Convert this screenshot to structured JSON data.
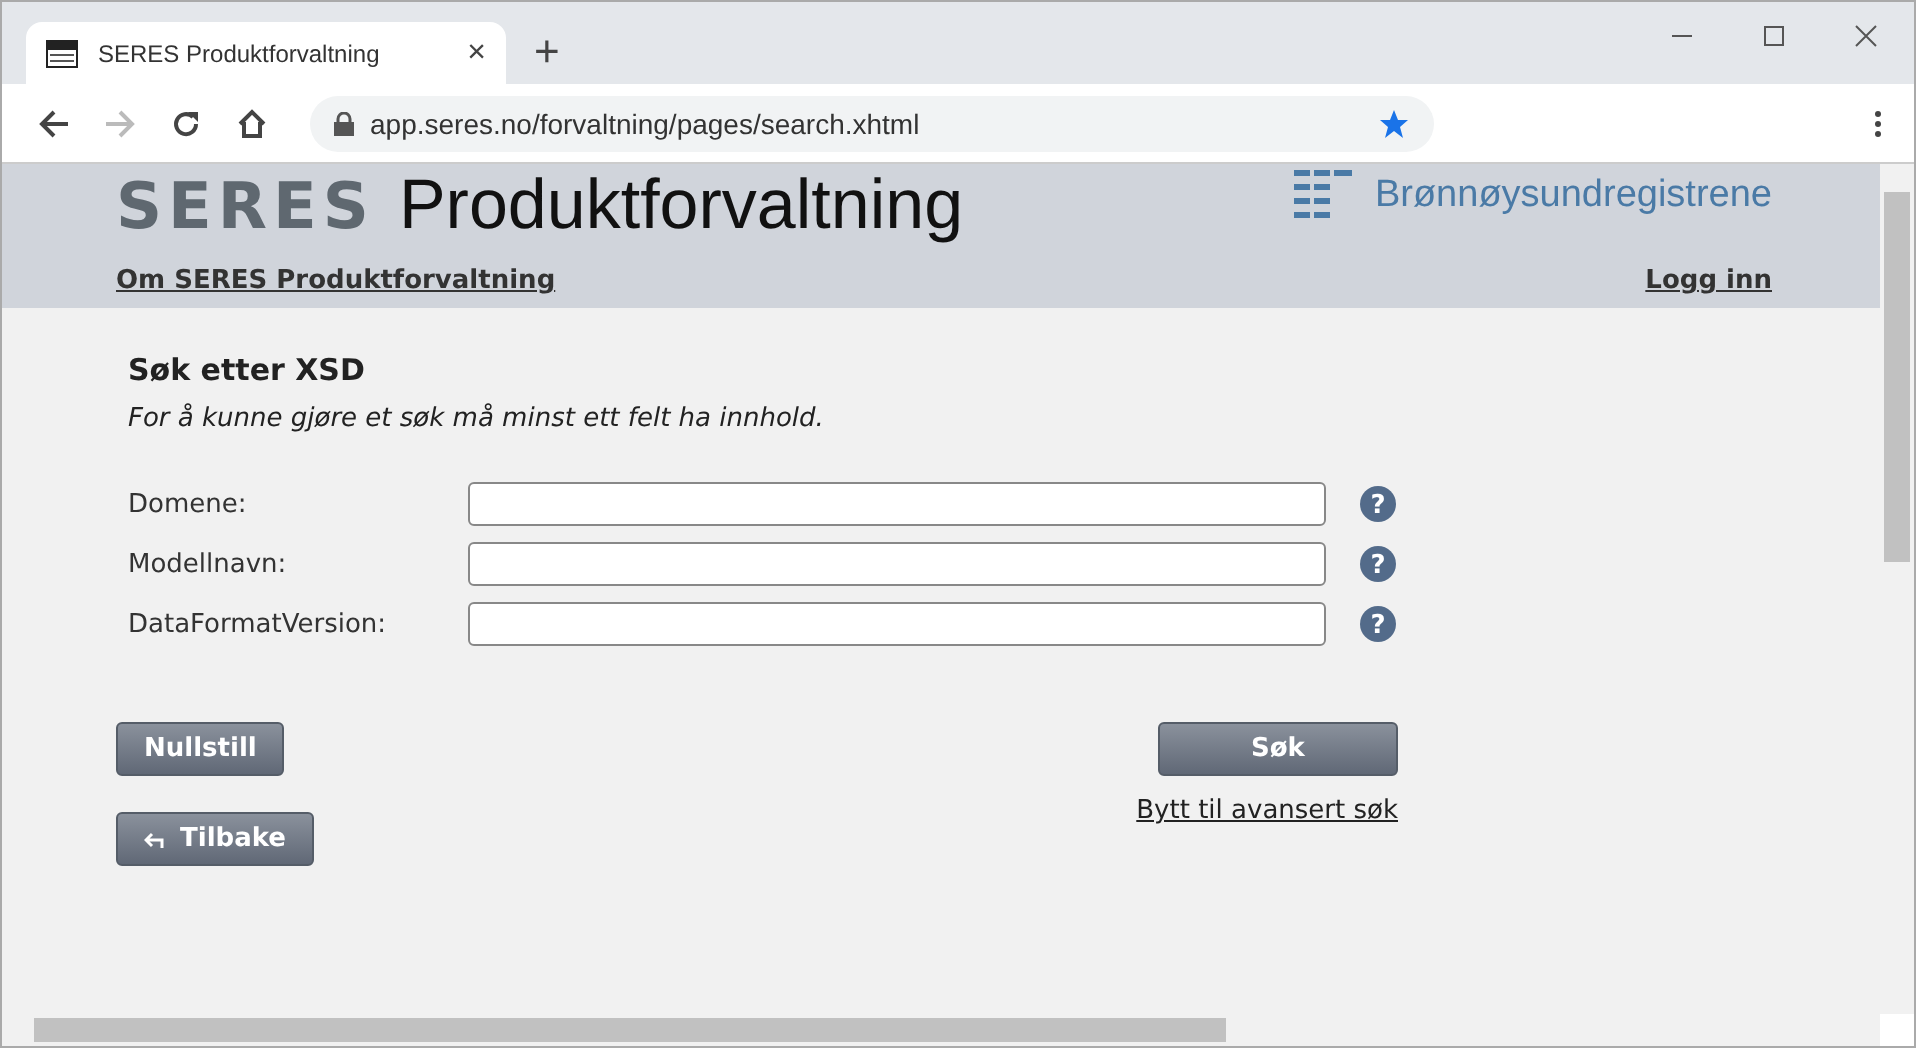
{
  "browser": {
    "tab": {
      "title": "SERES Produktforvaltning",
      "close": "×"
    },
    "new_tab": "+",
    "address": "app.seres.no/forvaltning/pages/search.xhtml"
  },
  "header": {
    "logo": "SERES",
    "title": "Produktforvaltning",
    "org": "Brønnøysundregistrene",
    "about_link": "Om SERES Produktforvaltning",
    "login_link": "Logg inn"
  },
  "form": {
    "heading": "Søk etter XSD",
    "hint": "For å kunne gjøre et søk må minst ett felt ha innhold.",
    "fields": [
      {
        "label": "Domene:",
        "help": "?"
      },
      {
        "label": "Modellnavn:",
        "help": "?"
      },
      {
        "label": "DataFormatVersion:",
        "help": "?"
      }
    ],
    "reset_button": "Nullstill",
    "search_button": "Søk",
    "advanced_link": "Bytt til avansert søk",
    "back_button": "Tilbake"
  }
}
